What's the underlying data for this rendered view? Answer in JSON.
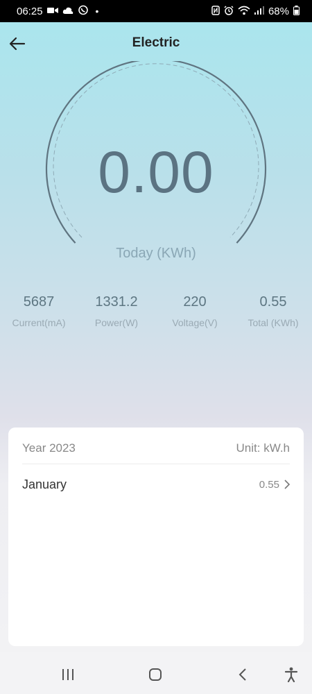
{
  "status_bar": {
    "time": "06:25",
    "battery": "68%",
    "left_icons": [
      "video-icon",
      "cloud-icon",
      "viber-icon"
    ],
    "right_icons": [
      "nfc-icon",
      "alarm-icon",
      "wifi-icon",
      "signal-icon",
      "battery-icon"
    ]
  },
  "header": {
    "title": "Electric"
  },
  "gauge": {
    "value": "0.00",
    "caption": "Today (KWh)"
  },
  "metrics": [
    {
      "value": "5687",
      "label": "Current(mA)"
    },
    {
      "value": "1331.2",
      "label": "Power(W)"
    },
    {
      "value": "220",
      "label": "Voltage(V)"
    },
    {
      "value": "0.55",
      "label": "Total (KWh)"
    }
  ],
  "history": {
    "year_label": "Year 2023",
    "unit_label": "Unit: kW.h",
    "months": [
      {
        "name": "January",
        "value": "0.55"
      }
    ]
  },
  "colors": {
    "accent": "#5b7382",
    "gauge_arc": "#5f7480",
    "bg_top": "#a8e6ee"
  }
}
